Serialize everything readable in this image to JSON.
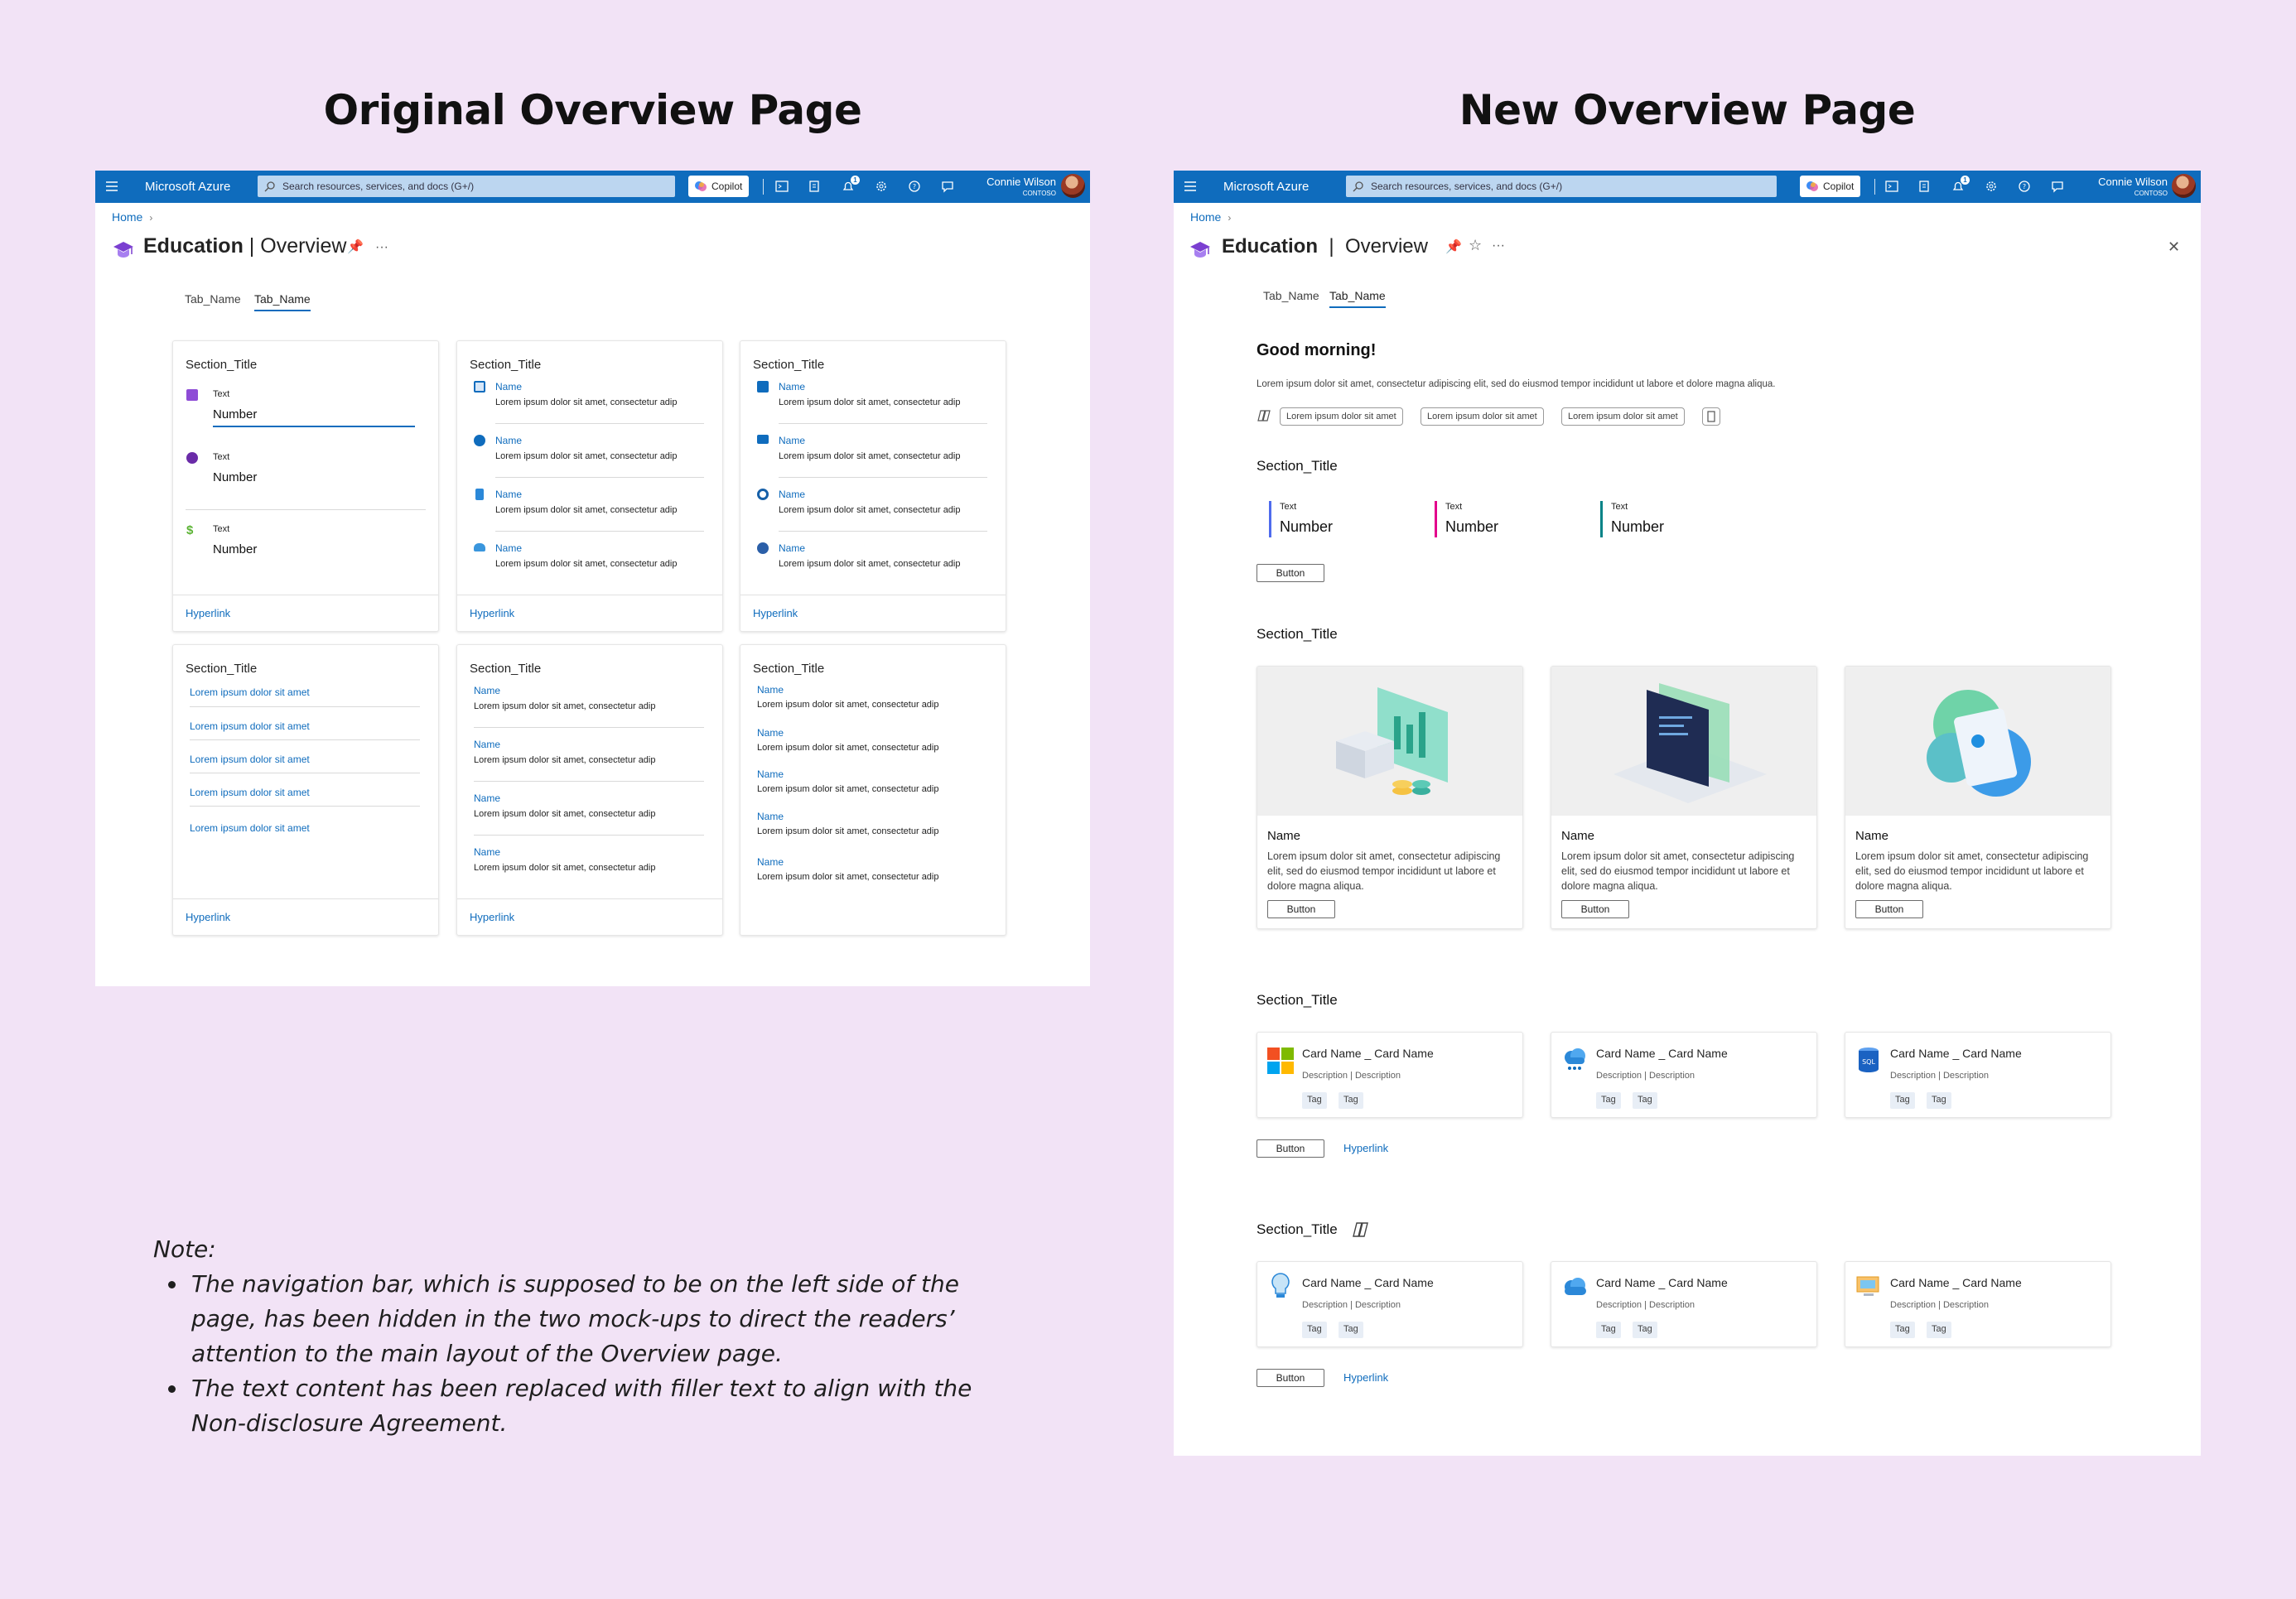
{
  "headings": {
    "left": "Original Overview Page",
    "right": "New Overview Page"
  },
  "shell": {
    "brand": "Microsoft Azure",
    "search_placeholder": "Search resources, services, and docs (G+/)",
    "copilot": "Copilot",
    "notif_count": "1",
    "user_name": "Connie Wilson",
    "tenant": "CONTOSO"
  },
  "breadcrumb": {
    "home": "Home",
    "chevron": "›"
  },
  "page_title": {
    "name": "Education",
    "divider": "|",
    "section": "Overview",
    "more": "···",
    "pin": "📌",
    "star": "☆",
    "close": "✕"
  },
  "tabs": [
    "Tab_Name",
    "Tab_Name"
  ],
  "original": {
    "card1": {
      "title": "Section_Title",
      "metrics": [
        {
          "label": "Text",
          "value": "Number"
        },
        {
          "label": "Text",
          "value": "Number"
        },
        {
          "label": "Text",
          "value": "Number"
        }
      ],
      "link": "Hyperlink"
    },
    "card2": {
      "title": "Section_Title",
      "items": [
        {
          "name": "Name",
          "desc": "Lorem ipsum dolor sit amet, consectetur adip"
        },
        {
          "name": "Name",
          "desc": "Lorem ipsum dolor sit amet, consectetur adip"
        },
        {
          "name": "Name",
          "desc": "Lorem ipsum dolor sit amet, consectetur adip"
        },
        {
          "name": "Name",
          "desc": "Lorem ipsum dolor sit amet, consectetur adip"
        }
      ],
      "link": "Hyperlink"
    },
    "card3": {
      "title": "Section_Title",
      "items": [
        {
          "name": "Name",
          "desc": "Lorem ipsum dolor sit amet, consectetur adip"
        },
        {
          "name": "Name",
          "desc": "Lorem ipsum dolor sit amet, consectetur adip"
        },
        {
          "name": "Name",
          "desc": "Lorem ipsum dolor sit amet, consectetur adip"
        },
        {
          "name": "Name",
          "desc": "Lorem ipsum dolor sit amet, consectetur adip"
        }
      ],
      "link": "Hyperlink"
    },
    "card4": {
      "title": "Section_Title",
      "links": [
        "Lorem ipsum dolor sit amet",
        "Lorem ipsum dolor sit amet",
        "Lorem ipsum dolor sit amet",
        "Lorem ipsum dolor sit amet",
        "Lorem ipsum dolor sit amet"
      ],
      "link": "Hyperlink"
    },
    "card5": {
      "title": "Section_Title",
      "items": [
        {
          "name": "Name",
          "desc": "Lorem ipsum dolor sit amet, consectetur adip"
        },
        {
          "name": "Name",
          "desc": "Lorem ipsum dolor sit amet, consectetur adip"
        },
        {
          "name": "Name",
          "desc": "Lorem ipsum dolor sit amet, consectetur adip"
        },
        {
          "name": "Name",
          "desc": "Lorem ipsum dolor sit amet, consectetur adip"
        }
      ],
      "link": "Hyperlink"
    },
    "card6": {
      "title": "Section_Title",
      "items": [
        {
          "name": "Name",
          "desc": "Lorem ipsum dolor sit amet, consectetur adip"
        },
        {
          "name": "Name",
          "desc": "Lorem ipsum dolor sit amet, consectetur adip"
        },
        {
          "name": "Name",
          "desc": "Lorem ipsum dolor sit amet, consectetur adip"
        },
        {
          "name": "Name",
          "desc": "Lorem ipsum dolor sit amet, consectetur adip"
        },
        {
          "name": "Name",
          "desc": "Lorem ipsum dolor sit amet, consectetur adip"
        }
      ]
    }
  },
  "new": {
    "greeting": "Good morning!",
    "intro": "Lorem ipsum dolor sit amet, consectetur adipiscing elit, sed do eiusmod tempor incididunt ut labore et dolore magna aliqua.",
    "chips": [
      "Lorem ipsum dolor sit amet",
      "Lorem ipsum dolor sit amet",
      "Lorem ipsum dolor sit amet"
    ],
    "metrics_section": {
      "title": "Section_Title",
      "metrics": [
        {
          "label": "Text",
          "value": "Number",
          "color": "#4f6bed"
        },
        {
          "label": "Text",
          "value": "Number",
          "color": "#e3008c"
        },
        {
          "label": "Text",
          "value": "Number",
          "color": "#038387"
        }
      ],
      "button": "Button"
    },
    "image_section": {
      "title": "Section_Title",
      "cards": [
        {
          "name": "Name",
          "desc": "Lorem ipsum dolor sit amet, consectetur adipiscing elit, sed do eiusmod tempor incididunt ut labore et dolore magna aliqua.",
          "button": "Button"
        },
        {
          "name": "Name",
          "desc": "Lorem ipsum dolor sit amet, consectetur adipiscing elit, sed do eiusmod tempor incididunt ut labore et dolore magna aliqua.",
          "button": "Button"
        },
        {
          "name": "Name",
          "desc": "Lorem ipsum dolor sit amet, consectetur adipiscing elit, sed do eiusmod tempor incididunt ut labore et dolore magna aliqua.",
          "button": "Button"
        }
      ]
    },
    "resource_section": {
      "title": "Section_Title",
      "cards": [
        {
          "name": "Card Name _ Card Name",
          "desc": "Description | Description",
          "tags": [
            "Tag",
            "Tag"
          ]
        },
        {
          "name": "Card Name _ Card Name",
          "desc": "Description | Description",
          "tags": [
            "Tag",
            "Tag"
          ]
        },
        {
          "name": "Card Name _ Card Name",
          "desc": "Description | Description",
          "tags": [
            "Tag",
            "Tag"
          ]
        }
      ],
      "button": "Button",
      "link": "Hyperlink"
    },
    "copilot_section": {
      "title": "Section_Title",
      "cards": [
        {
          "name": "Card Name _ Card Name",
          "desc": "Description | Description",
          "tags": [
            "Tag",
            "Tag"
          ]
        },
        {
          "name": "Card Name _ Card Name",
          "desc": "Description | Description",
          "tags": [
            "Tag",
            "Tag"
          ]
        },
        {
          "name": "Card Name _ Card Name",
          "desc": "Description | Description",
          "tags": [
            "Tag",
            "Tag"
          ]
        }
      ],
      "button": "Button",
      "link": "Hyperlink"
    }
  },
  "note": {
    "title": "Note:",
    "items": [
      "The navigation bar, which is supposed to be on the left side of the page, has been hidden in the two mock-ups to direct the readers’ attention to the main layout of the Overview page.",
      "The text content has been replaced with filler text to align with the Non-disclosure Agreement."
    ]
  },
  "colors": {
    "accent": "#0f6cbd",
    "background": "#f2e3f6"
  }
}
